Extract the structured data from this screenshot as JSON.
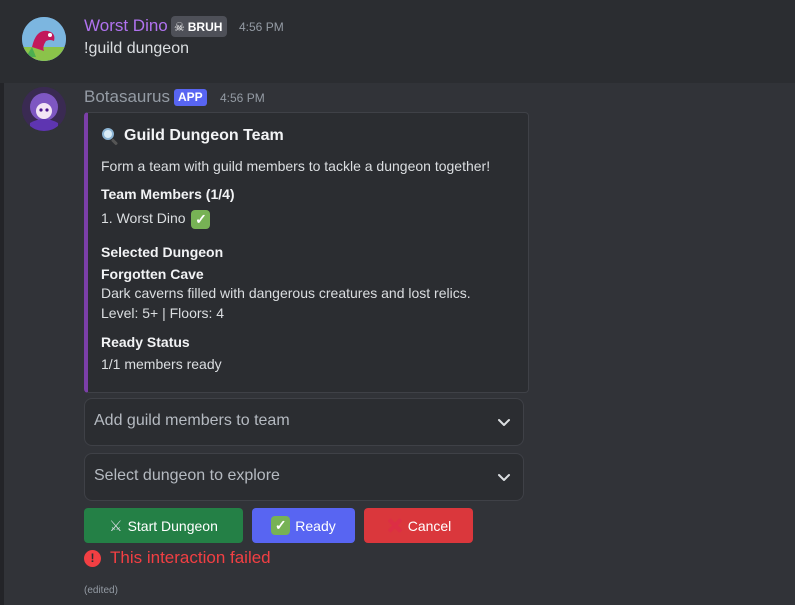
{
  "message1": {
    "username": "Worst Dino",
    "tag": "BRUH",
    "timestamp": "4:56 PM",
    "content": "!guild dungeon"
  },
  "message2": {
    "username": "Botasaurus",
    "tag": "APP",
    "timestamp": "4:56 PM",
    "embed": {
      "title": "Guild Dungeon Team",
      "title_icon": "magnifying-glass-icon",
      "description": "Form a team with guild members to tackle a dungeon together!",
      "members_heading": "Team Members (1/4)",
      "member_1": "1. Worst Dino",
      "dungeon_heading": "Selected Dungeon",
      "dungeon_name": "Forgotten Cave",
      "dungeon_desc": "Dark caverns filled with dangerous creatures and lost relics.",
      "dungeon_meta": "Level: 5+ | Floors: 4",
      "ready_heading": "Ready Status",
      "ready_value": "1/1 members ready",
      "accent_color": "#7b3fa8"
    },
    "select_members_placeholder": "Add guild members to team",
    "select_dungeon_placeholder": "Select dungeon to explore",
    "buttons": {
      "start": "Start Dungeon",
      "ready": "Ready",
      "cancel": "Cancel"
    },
    "error": "This interaction failed",
    "edited": "(edited)"
  },
  "colors": {
    "start_button": "#248046",
    "ready_button": "#5865f2",
    "cancel_button": "#da373c",
    "error_text": "#f23f43",
    "username_1": "#b072ef"
  }
}
